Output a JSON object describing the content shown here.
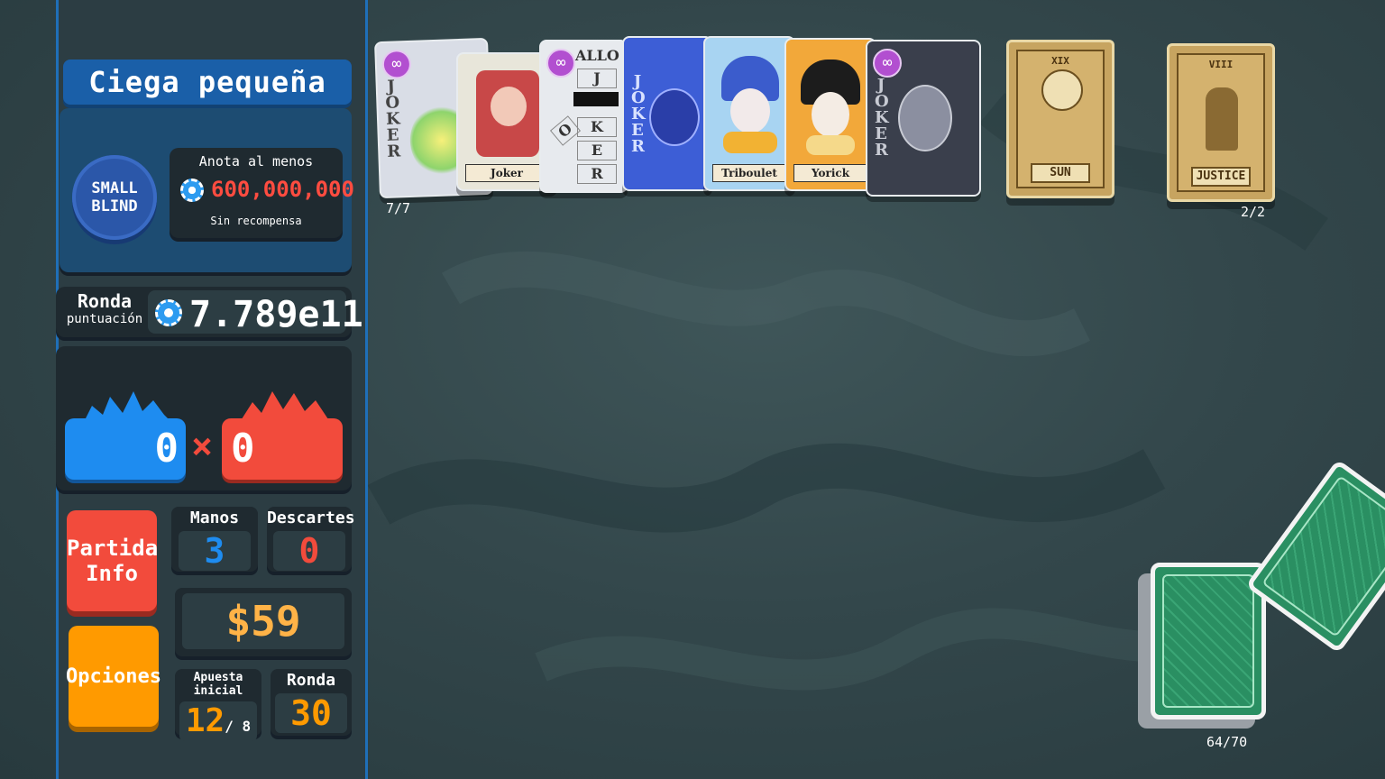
{
  "blind": {
    "title": "Ciega pequeña",
    "chip_line1": "SMALL",
    "chip_line2": "BLIND",
    "target_label": "Anota al menos",
    "target_value": "600,000,000",
    "reward": "Sin recompensa"
  },
  "round_score": {
    "label": "Ronda",
    "sublabel": "puntuación",
    "value": "7.789e11"
  },
  "hand_calc": {
    "chips": "0",
    "times": "×",
    "mult": "0"
  },
  "buttons": {
    "run_info_line1": "Partida",
    "run_info_line2": "Info",
    "options": "Opciones"
  },
  "stats": {
    "hands_label": "Manos",
    "hands_value": "3",
    "discards_label": "Descartes",
    "discards_value": "0",
    "money": "$59",
    "ante_label": "Apuesta inicial",
    "ante_value": "12",
    "ante_max": "/ 8",
    "round_label": "Ronda",
    "round_value": "30"
  },
  "jokers": {
    "count": "7/7",
    "cards": [
      {
        "name": "Joker",
        "edition": "negative"
      },
      {
        "name": "Joker"
      },
      {
        "name": "Hallucination",
        "letters": [
          "J",
          "O",
          "K",
          "E",
          "R"
        ],
        "header": "ALLO"
      },
      {
        "name": "Joker"
      },
      {
        "name": "Triboulet"
      },
      {
        "name": "Yorick"
      },
      {
        "name": "Joker",
        "edition": "negative"
      }
    ],
    "negative_icon": "∞",
    "vertical_text": "JOKER",
    "name_labels": [
      "Joker",
      "Triboulet",
      "Yorick"
    ]
  },
  "consumables": {
    "count": "2/2",
    "cards": [
      {
        "name": "SUN",
        "numeral": "XIX"
      },
      {
        "name": "JUSTICE",
        "numeral": "VIII"
      }
    ]
  },
  "deck": {
    "count": "64/70"
  },
  "colors": {
    "chips": "#1e8cf0",
    "mult": "#f24b3c",
    "money": "#ffb347",
    "options": "#ff9a00",
    "sidebar_border": "#1f6fb8"
  }
}
